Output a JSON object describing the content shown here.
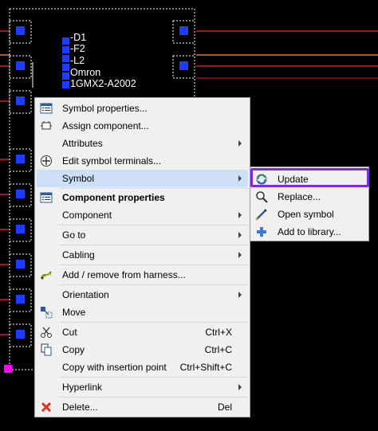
{
  "schematic": {
    "labels": [
      "-D1",
      "-F2",
      "-L2",
      "Omron",
      "1GMX2-A2002"
    ]
  },
  "context_menu": {
    "items": [
      {
        "label": "Symbol properties...",
        "icon": "symbol-properties-icon"
      },
      {
        "label": "Assign component...",
        "icon": "assign-component-icon"
      },
      {
        "label": "Attributes",
        "submenu": true
      },
      {
        "label": "Edit symbol terminals...",
        "icon": "edit-terminals-icon"
      },
      {
        "label": "Symbol",
        "submenu": true,
        "highlighted": true
      },
      {
        "label": "Component properties",
        "icon": "component-properties-icon",
        "bold": true
      },
      {
        "label": "Component",
        "submenu": true
      },
      {
        "label": "Go to",
        "submenu": true
      },
      {
        "label": "Cabling",
        "submenu": true
      },
      {
        "label": "Add / remove from harness...",
        "icon": "harness-icon"
      },
      {
        "label": "Orientation",
        "submenu": true
      },
      {
        "label": "Move",
        "icon": "move-icon"
      },
      {
        "label": "Cut",
        "shortcut": "Ctrl+X",
        "icon": "cut-icon"
      },
      {
        "label": "Copy",
        "shortcut": "Ctrl+C",
        "icon": "copy-icon"
      },
      {
        "label": "Copy with insertion point",
        "shortcut": "Ctrl+Shift+C"
      },
      {
        "label": "Hyperlink",
        "submenu": true
      },
      {
        "label": "Delete...",
        "shortcut": "Del",
        "icon": "delete-icon"
      }
    ]
  },
  "submenu": {
    "items": [
      {
        "label": "Update",
        "icon": "update-icon",
        "focused": true
      },
      {
        "label": "Replace...",
        "icon": "replace-icon"
      },
      {
        "label": "Open symbol",
        "icon": "open-symbol-icon"
      },
      {
        "label": "Add to library...",
        "icon": "add-library-icon"
      }
    ]
  },
  "colors": {
    "menu_bg": "#f0f0f0",
    "highlight": "#cce0f7",
    "focus_outline": "#7b2ae0",
    "terminal": "#1c3cff",
    "wire_red": "#d81e1e",
    "wire_orange": "#e07a10"
  }
}
